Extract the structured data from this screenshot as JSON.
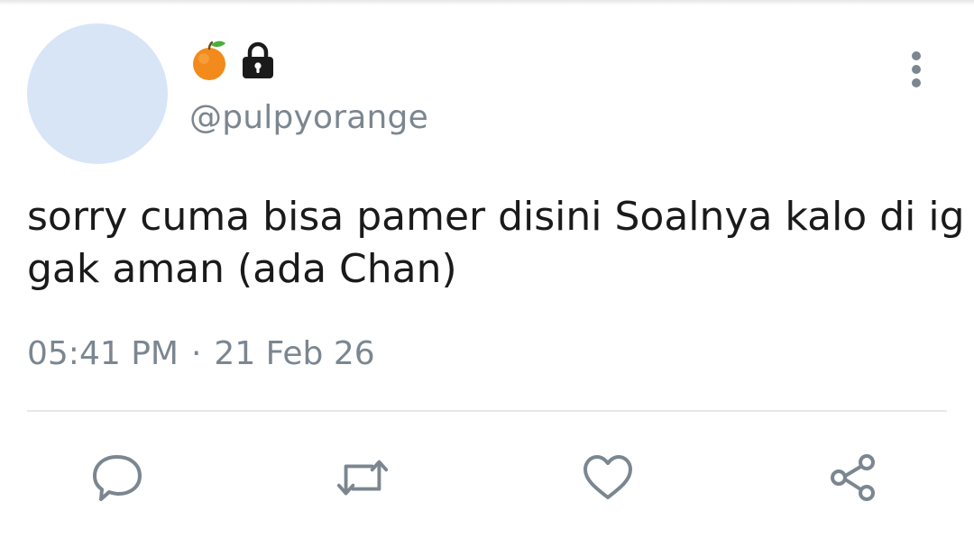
{
  "tweet": {
    "handle": "@pulpyorange",
    "text": "sorry cuma bisa pamer disini Soalnya kalo di ig gak aman (ada Chan)",
    "time": "05:41 PM",
    "separator": "·",
    "date": "21 Feb 26"
  },
  "icons": {
    "name": [
      "orange-emoji-icon",
      "lock-icon"
    ],
    "menu": "more-vertical-icon",
    "actions": [
      "reply-icon",
      "retweet-icon",
      "like-icon",
      "share-icon"
    ]
  },
  "colors": {
    "avatar": "#d7e5f7",
    "icon_gray": "#7b8690",
    "text": "#1a1a1a"
  }
}
